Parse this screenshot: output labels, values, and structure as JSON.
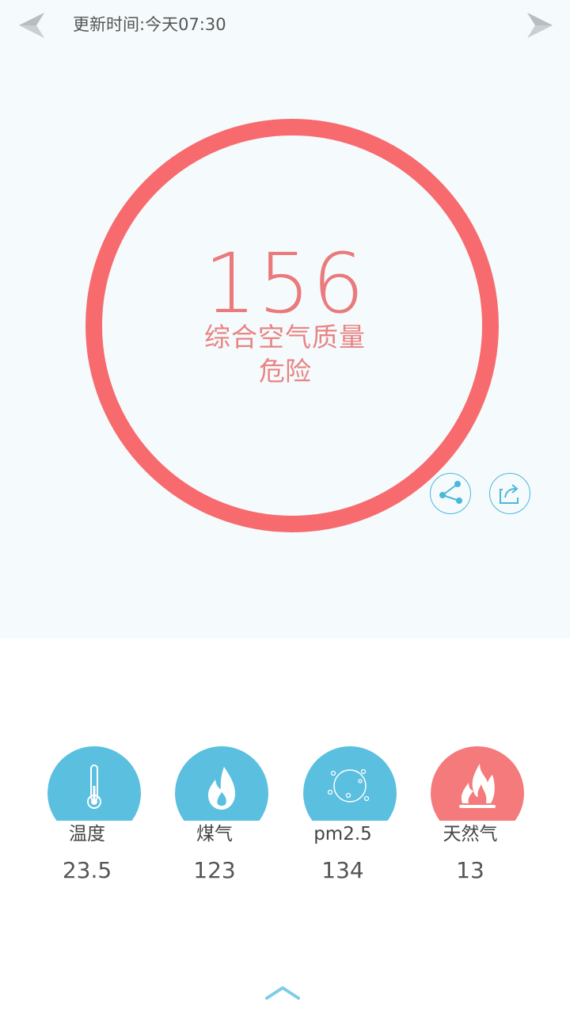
{
  "header": {
    "update_label": "更新时间:",
    "update_value": "今天07:30"
  },
  "aqi": {
    "value": "156",
    "label": "综合空气质量",
    "status": "危险",
    "ring_color": "#f76b6f",
    "text_color": "#ea7a7c"
  },
  "actions": {
    "share_icon": "share-icon",
    "forward_icon": "forward-icon",
    "accent": "#4cb7d9"
  },
  "sensors": [
    {
      "name": "温度",
      "value": "23.5",
      "icon": "thermometer-icon",
      "color": "#5bbfdf"
    },
    {
      "name": "煤气",
      "value": "123",
      "icon": "flame-icon",
      "color": "#5bbfdf"
    },
    {
      "name": "pm2.5",
      "value": "134",
      "icon": "particles-icon",
      "color": "#5bbfdf"
    },
    {
      "name": "天然气",
      "value": "13",
      "icon": "fire-icon",
      "color": "#f47a7c"
    }
  ],
  "footer": {
    "expand_icon": "chevron-up-icon"
  }
}
